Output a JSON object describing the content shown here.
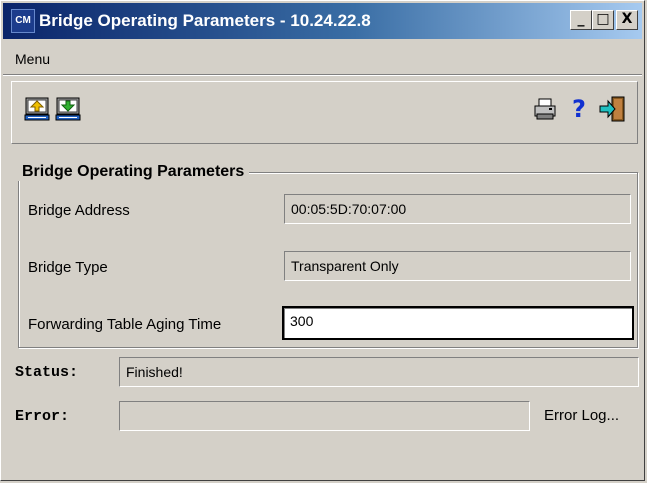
{
  "window": {
    "title": "Bridge Operating Parameters - 10.24.22.8",
    "app_icon_text": "CM",
    "controls": {
      "minimize": "_",
      "maximize": "□",
      "close": "X"
    }
  },
  "menu": {
    "items": [
      {
        "label": "Menu"
      }
    ]
  },
  "toolbar": {
    "left_tools": [
      "upload-icon",
      "download-icon"
    ],
    "right_tools": [
      "print-icon",
      "help-icon",
      "exit-icon"
    ],
    "help_glyph": "?"
  },
  "group": {
    "title": "Bridge Operating Parameters",
    "fields": {
      "bridge_address": {
        "label": "Bridge Address",
        "value": "00:05:5D:70:07:00"
      },
      "bridge_type": {
        "label": "Bridge Type",
        "value": "Transparent Only"
      },
      "aging_time": {
        "label": "Forwarding Table Aging Time",
        "value": "300"
      }
    }
  },
  "status": {
    "label": "Status:",
    "value": "Finished!"
  },
  "error": {
    "label": "Error:",
    "value": "",
    "log_link": "Error Log..."
  },
  "colors": {
    "title_start": "#0a246a",
    "title_end": "#a6caf0",
    "face": "#d4d0c8"
  }
}
